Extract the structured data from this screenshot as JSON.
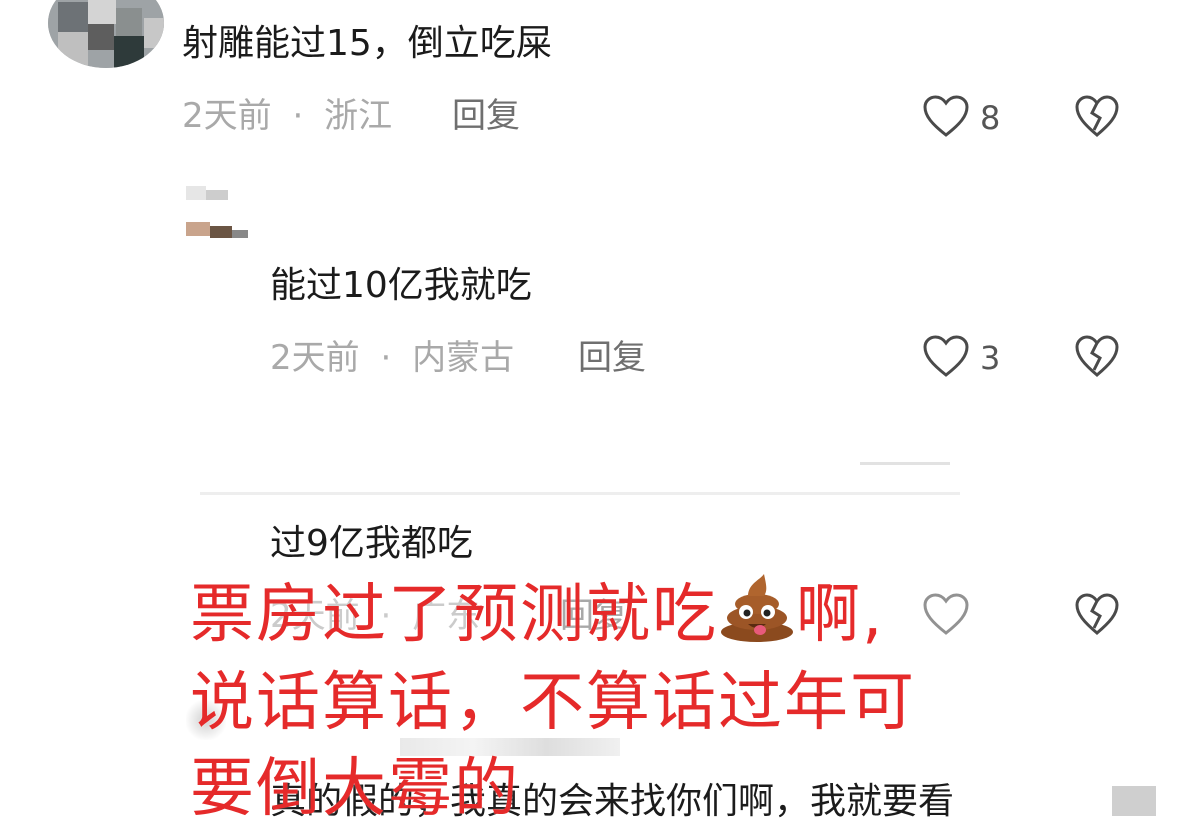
{
  "comments": [
    {
      "text": "射雕能过15，倒立吃屎",
      "time": "2天前",
      "sep": "·",
      "location": "浙江",
      "reply_label": "回复",
      "likes": "8"
    },
    {
      "text": "能过10亿我就吃",
      "time": "2天前",
      "sep": "·",
      "location": "内蒙古",
      "reply_label": "回复",
      "likes": "3"
    },
    {
      "text": "过9亿我都吃",
      "time": "2天前",
      "sep": "·",
      "location": "广东",
      "reply_label": "回复",
      "likes": ""
    }
  ],
  "bottom_comment": {
    "text": "真的假的，我真的会来找你们啊，我就要看"
  },
  "overlay": {
    "line1_a": "票房过了预测就吃",
    "line1_b": "啊,",
    "line2": "说话算话，不算话过年可",
    "line3": "要倒大霉的"
  },
  "icons": {
    "like": "heart-outline-icon",
    "dislike": "broken-heart-icon",
    "emoji": "poop-emoji-icon"
  },
  "colors": {
    "overlay_red": "#e52a2a",
    "meta_gray": "#a9a9a9",
    "text_dark": "#1b1b1b"
  }
}
